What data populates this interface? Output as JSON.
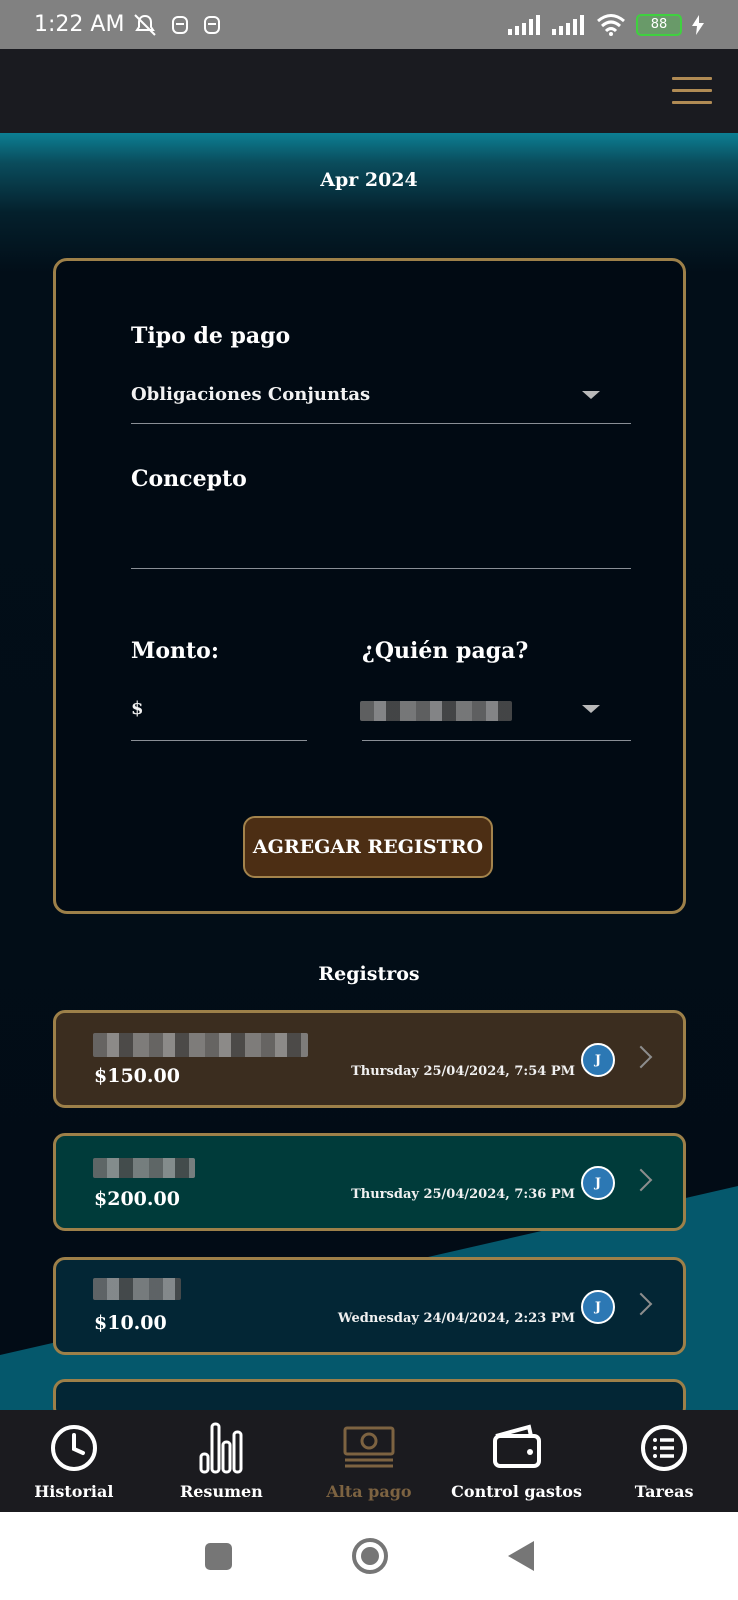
{
  "status_bar": {
    "time": "1:22 AM",
    "battery": "88",
    "icons": [
      "mute-off-icon",
      "app-icon",
      "app-icon",
      "signal-icon",
      "signal-icon",
      "wifi-icon",
      "battery-icon",
      "charging-icon"
    ]
  },
  "app_bar": {
    "menu_icon": "hamburger-icon"
  },
  "header": {
    "month": "Apr 2024"
  },
  "form": {
    "payment_type_label": "Tipo de pago",
    "payment_type_value": "Obligaciones Conjuntas",
    "concept_label": "Concepto",
    "concept_value": "",
    "amount_label": "Monto:",
    "currency_symbol": "$",
    "amount_value": "",
    "payer_label": "¿Quién paga?",
    "submit_label": "AGREGAR REGISTRO"
  },
  "records": {
    "title": "Registros",
    "items": [
      {
        "amount": "$150.00",
        "date": "Thursday 25/04/2024, 7:54 PM",
        "avatar": "J",
        "color": "#3b2d1f"
      },
      {
        "amount": "$200.00",
        "date": "Thursday 25/04/2024, 7:36 PM",
        "avatar": "J",
        "color": "#003b3a"
      },
      {
        "amount": "$10.00",
        "date": "Wednesday 24/04/2024, 2:23 PM",
        "avatar": "J",
        "color": "#032635"
      }
    ]
  },
  "bottom_nav": {
    "items": [
      {
        "label": "Historial",
        "icon": "clock-icon"
      },
      {
        "label": "Resumen",
        "icon": "bar-chart-icon"
      },
      {
        "label": "Alta pago",
        "icon": "money-icon",
        "active": true
      },
      {
        "label": "Control gastos",
        "icon": "wallet-icon"
      },
      {
        "label": "Tareas",
        "icon": "list-icon"
      }
    ]
  },
  "colors": {
    "accent_gold": "#9d8049",
    "active_nav": "#7d6341",
    "button_bg": "#4c2e14",
    "avatar_bg": "#2c78b4"
  }
}
